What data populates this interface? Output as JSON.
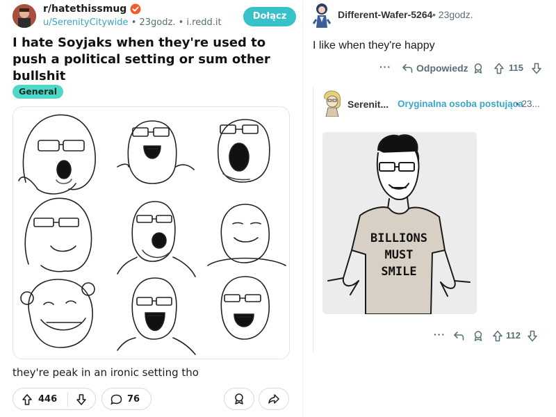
{
  "post": {
    "subreddit": "r/hatethissmug",
    "author": "u/SerenityCitywide",
    "time": "23godz.",
    "domain": "i.redd.it",
    "sep1": "•",
    "sep2": "•",
    "join_label": "Dołącz",
    "title": "I hate Soyjaks when they're used to push a political setting or sum other bullshit",
    "flair": "General",
    "caption": "they're peak in an ironic setting tho",
    "upvotes": "446",
    "comments": "76"
  },
  "comment1": {
    "author": "Different-Wafer-5264",
    "time": "• 23godz.",
    "body": "I like when they're happy",
    "more": "···",
    "reply_label": "Odpowiedz",
    "score": "115"
  },
  "comment2": {
    "author": "Serenit...",
    "op_label": "Oryginalna osoba postująca",
    "time": "• 23...",
    "shirt_text": "BILLIONS MUST SMILE",
    "shirt_line1": "BILLIONS",
    "shirt_line2": "MUST",
    "shirt_line3": "SMILE",
    "more": "···",
    "score": "112"
  },
  "colors": {
    "accent_teal": "#37c2c9",
    "flair_bg": "#4fd8c6",
    "link_blue": "#3aa6c7",
    "meta_gray": "#576f76"
  },
  "icons": [
    "verified-badge-icon",
    "upvote-icon",
    "downvote-icon",
    "comment-icon",
    "award-icon",
    "share-icon",
    "reply-icon",
    "more-icon"
  ]
}
